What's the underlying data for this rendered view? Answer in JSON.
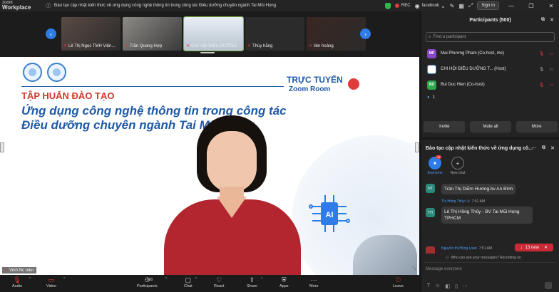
{
  "titlebar": {
    "brand_line1": "zoom",
    "brand_line2": "Workplace",
    "window_title": "Đào tạo cập nhật kiến thức về ứng dụng công nghệ thông tin trong  công tác Điều dưỡng  chuyên ngành Tai Mũi Họng",
    "rec_label": "REC",
    "facebook_label": "facebook",
    "signin_label": "Sign In",
    "minimize": "—",
    "maximize": "❐",
    "close": "✕"
  },
  "gallery": {
    "thumbnails": [
      {
        "name": "Lê Thị Ngọc TMH Viện..."
      },
      {
        "name": "Trần Quang Hợp"
      },
      {
        "name": "CHI HỘI ĐIỀU DƯỠNG"
      },
      {
        "name": "Thùy hằng"
      },
      {
        "name": "liên hoàng"
      }
    ]
  },
  "slide": {
    "online": "TRỰC TUYẾN",
    "zoom_room": "Zoom Room",
    "training": "TẬP HUẤN ĐÀO TẠO",
    "topic_line1": "Ứng dụng công nghệ thông tin trong công tác",
    "topic_line2": "Điều dưỡng chuyên ngành Tai Mũi Họng",
    "ai_label": "AI",
    "presenter_tag": "Vinh Nc oder"
  },
  "participants": {
    "title": "Participants (500)",
    "search_placeholder": "Find a participant",
    "rows": [
      {
        "initials": "MP",
        "name": "Mai Phương Pham (Co-host, me)",
        "color": "#8b46c9"
      },
      {
        "initials": "",
        "name": "CHI HỘI ĐIỀU DƯỠNG T...  (Host)",
        "color": "#ffffff"
      },
      {
        "initials": "BD",
        "name": "Bui Duc Hien (Co-host)",
        "color": "#2fa84a"
      }
    ],
    "count": "1",
    "invite": "Invite",
    "mute_all": "Mute all",
    "more": "More"
  },
  "chat": {
    "title": "Đào tạo cập nhật kiến thức về ứng dụng cô...",
    "tab_everyone": "Everyone",
    "tab_everyone_badge": "13",
    "tab_new_chat": "New chat",
    "messages": [
      {
        "initials": "NT",
        "text": "Trần Thị Diễm Hương.bv An Bình"
      },
      {
        "initials": "TH",
        "sender": "Thị Hồng Thủy Lê",
        "time": "7:51 AM",
        "text_line1": "Lê Thị Hồng Thủy - BV Tai Mũi Họng",
        "text_line2": "TPHCM"
      },
      {
        "sender": "Nguyễn thị Hồng Loan",
        "time": "7:51 AM"
      }
    ],
    "new_messages": "13 new",
    "who_can_see": "Who can see your messages? Recording on",
    "compose_placeholder": "Message everyone"
  },
  "toolbar": {
    "audio": "Audio",
    "video": "Video",
    "participants": "Participants",
    "participants_count": "500",
    "chat": "Chat",
    "react": "React",
    "share": "Share",
    "apps": "Apps",
    "more": "More",
    "leave": "Leave"
  },
  "colors": {
    "accent": "#2d7ce8",
    "danger": "#e23b3b",
    "slide_blue": "#1e5aa8",
    "slide_red": "#d1362a"
  }
}
